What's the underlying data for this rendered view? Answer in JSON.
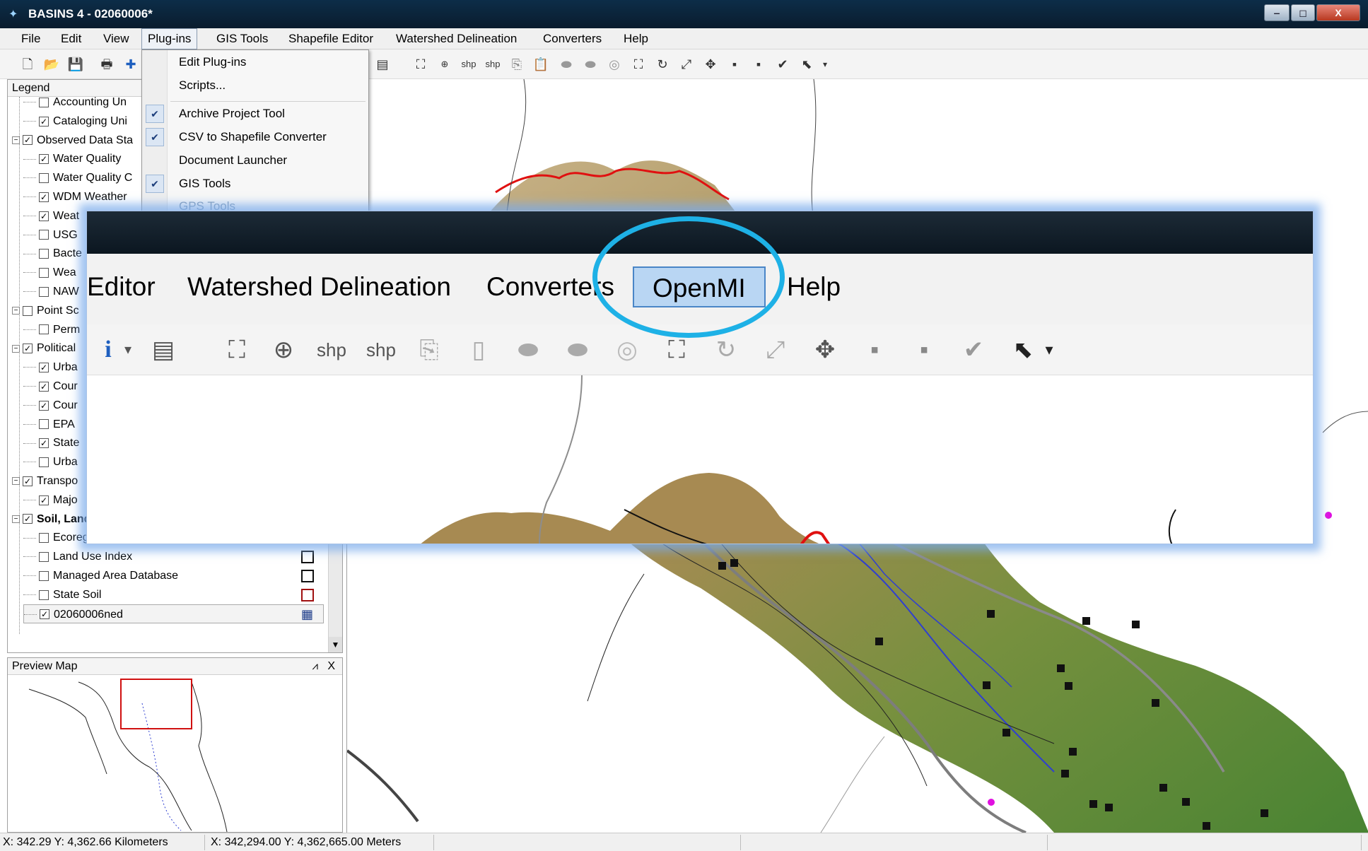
{
  "window": {
    "title": "BASINS 4  - 02060006*",
    "controls": [
      "‒",
      "◻",
      "X"
    ]
  },
  "menu": {
    "items": [
      "File",
      "Edit",
      "View",
      "Plug-ins",
      "GIS Tools",
      "Shapefile Editor",
      "Watershed Delineation",
      "Converters",
      "Help"
    ],
    "open_item": "Plug-ins"
  },
  "plugins_menu": {
    "items": [
      {
        "label": "Edit Plug-ins",
        "checked": false
      },
      {
        "label": "Scripts...",
        "checked": false
      },
      {
        "label": "Archive Project Tool",
        "checked": true
      },
      {
        "label": "CSV to Shapefile Converter",
        "checked": true
      },
      {
        "label": "Document Launcher",
        "checked": false
      },
      {
        "label": "GIS Tools",
        "checked": true
      },
      {
        "label": "GPS Tools",
        "checked": false
      }
    ]
  },
  "legend": {
    "title": "Legend",
    "rows": [
      {
        "label": "Accounting Un",
        "checked": false,
        "level": 2
      },
      {
        "label": "Cataloging Uni",
        "checked": true,
        "level": 2
      },
      {
        "label": "Observed Data Sta",
        "checked": true,
        "level": 1
      },
      {
        "label": "Water Quality",
        "checked": true,
        "level": 2
      },
      {
        "label": "Water Quality C",
        "checked": false,
        "level": 2
      },
      {
        "label": "WDM Weather",
        "checked": true,
        "level": 2
      },
      {
        "label": "Weat",
        "checked": true,
        "level": 2
      },
      {
        "label": "USG",
        "checked": false,
        "level": 2
      },
      {
        "label": "Bacte",
        "checked": false,
        "level": 2
      },
      {
        "label": "Wea",
        "checked": false,
        "level": 2
      },
      {
        "label": "NAW",
        "checked": false,
        "level": 2
      },
      {
        "label": "Point Sc",
        "checked": false,
        "level": 1
      },
      {
        "label": "Perm",
        "checked": false,
        "level": 2
      },
      {
        "label": "Political",
        "checked": true,
        "level": 1
      },
      {
        "label": "Urba",
        "checked": true,
        "level": 2
      },
      {
        "label": "Cour",
        "checked": true,
        "level": 2
      },
      {
        "label": "Cour",
        "checked": true,
        "level": 2
      },
      {
        "label": "EPA",
        "checked": false,
        "level": 2
      },
      {
        "label": "State",
        "checked": true,
        "level": 2
      },
      {
        "label": "Urba",
        "checked": false,
        "level": 2
      },
      {
        "label": "Transpo",
        "checked": true,
        "level": 1
      },
      {
        "label": "Majo",
        "checked": true,
        "level": 2
      },
      {
        "label": "Soil, Land Use/Cover",
        "checked": true,
        "level": 1
      },
      {
        "label": "Ecoregions (Level III)",
        "checked": false,
        "level": 2
      },
      {
        "label": "Land Use Index",
        "checked": false,
        "level": 2
      },
      {
        "label": "Managed Area Database",
        "checked": false,
        "level": 2
      },
      {
        "label": "State Soil",
        "checked": false,
        "level": 2
      },
      {
        "label": "02060006ned",
        "checked": true,
        "level": 2
      }
    ]
  },
  "preview": {
    "title": "Preview Map",
    "pin": "⩘",
    "close": "X"
  },
  "status": {
    "km": "X: 342.29   Y: 4,362.66 Kilometers",
    "m": "X: 342,294.00   Y: 4,362,665.00 Meters"
  },
  "zoom": {
    "menu": [
      "Editor",
      "Watershed Delineation",
      "Converters",
      "OpenMI",
      "Help"
    ],
    "highlighted": "OpenMI"
  },
  "colors": {
    "titlebar": "#0c2d48",
    "highlight_ring": "#1eb1e6",
    "selected_menu": "#b9d6f3",
    "watershed_boundary": "#ff0000",
    "terrain_high": "#a78a52",
    "terrain_low": "#4f8a2e"
  }
}
